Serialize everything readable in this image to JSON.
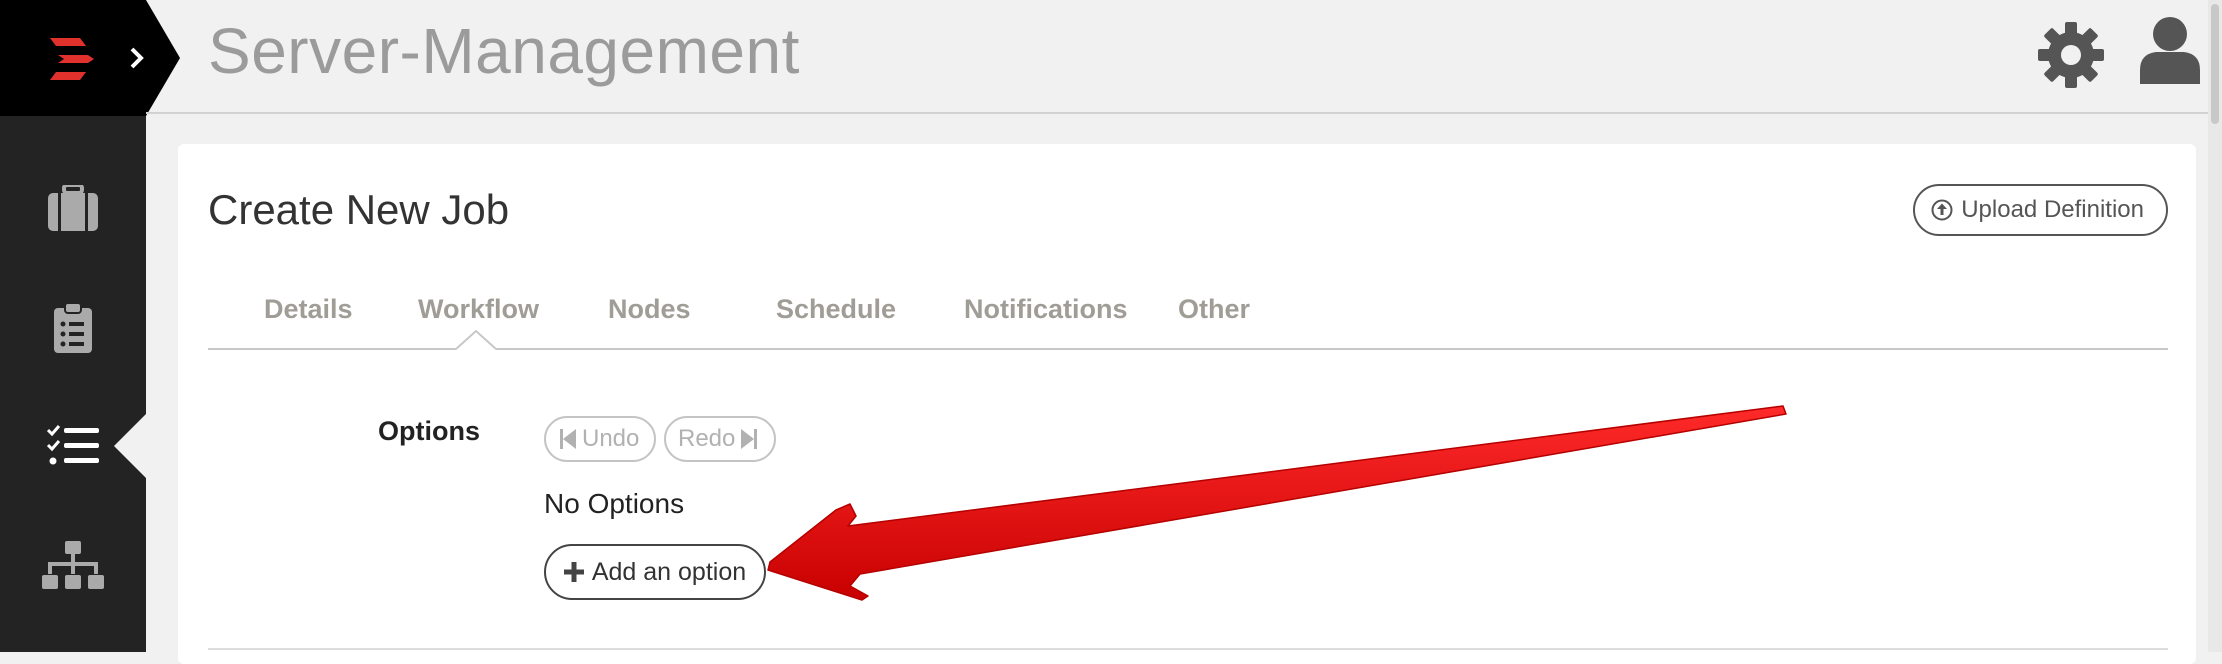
{
  "app": {
    "title": "Server-Management"
  },
  "sidebar": {
    "items": [
      {
        "icon": "briefcase-icon",
        "active": false
      },
      {
        "icon": "clipboard-list-icon",
        "active": false
      },
      {
        "icon": "task-list-icon",
        "active": true
      },
      {
        "icon": "hierarchy-icon",
        "active": false
      }
    ]
  },
  "header": {
    "icons": [
      "gear-icon",
      "user-icon"
    ]
  },
  "page": {
    "title": "Create New Job",
    "upload_label": "Upload Definition",
    "tabs": [
      {
        "label": "Details"
      },
      {
        "label": "Workflow"
      },
      {
        "label": "Nodes"
      },
      {
        "label": "Schedule"
      },
      {
        "label": "Notifications"
      },
      {
        "label": "Other"
      }
    ],
    "active_tab": "Workflow"
  },
  "options": {
    "label": "Options",
    "undo_label": "Undo",
    "redo_label": "Redo",
    "empty_text": "No Options",
    "add_label": "Add an option"
  },
  "colors": {
    "sidebar": "#232323",
    "logo_accent": "#e0312c",
    "annotation_arrow": "#e40000",
    "tab_text": "#a09d97"
  }
}
